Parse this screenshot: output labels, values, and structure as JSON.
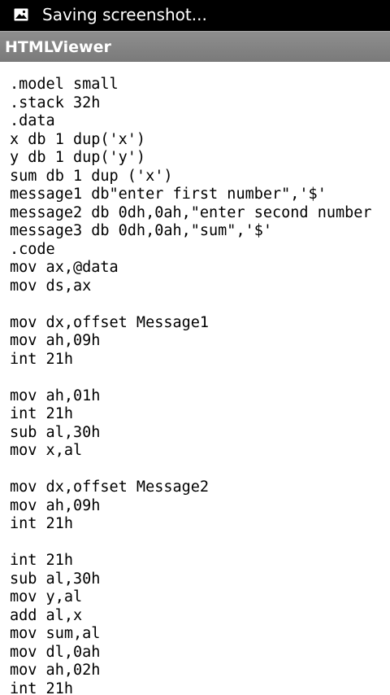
{
  "status_bar": {
    "icon": "image-icon",
    "text": "Saving screenshot..."
  },
  "app_bar": {
    "title": "HTMLViewer"
  },
  "document": {
    "lines": [
      ".model small",
      ".stack 32h",
      ".data",
      "x db 1 dup('x')",
      "y db 1 dup('y')",
      "sum db 1 dup ('x')",
      "message1 db\"enter first number\",'$'",
      "message2 db 0dh,0ah,\"enter second number",
      "message3 db 0dh,0ah,\"sum\",'$'",
      ".code",
      "mov ax,@data",
      "mov ds,ax",
      "",
      "mov dx,offset Message1",
      "mov ah,09h",
      "int 21h",
      "",
      "mov ah,01h",
      "int 21h",
      "sub al,30h",
      "mov x,al",
      "",
      "mov dx,offset Message2",
      "mov ah,09h",
      "int 21h",
      "",
      "int 21h",
      "sub al,30h",
      "mov y,al",
      "add al,x",
      "mov sum,al",
      "mov dl,0ah",
      "mov ah,02h",
      "int 21h"
    ]
  }
}
